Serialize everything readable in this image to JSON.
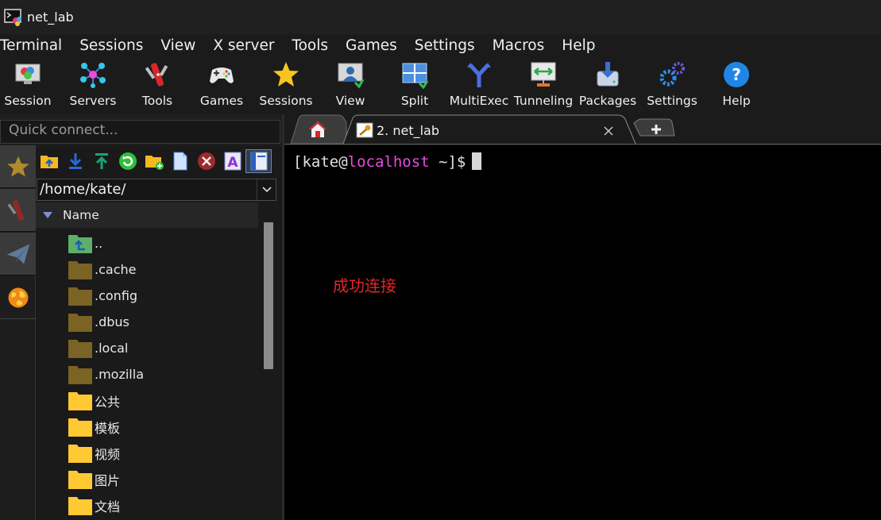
{
  "window": {
    "title": "net_lab"
  },
  "menu": [
    "Terminal",
    "Sessions",
    "View",
    "X server",
    "Tools",
    "Games",
    "Settings",
    "Macros",
    "Help"
  ],
  "toolbar": {
    "session": "Session",
    "servers": "Servers",
    "tools": "Tools",
    "games": "Games",
    "sessions": "Sessions",
    "view": "View",
    "split": "Split",
    "multiexec": "MultiExec",
    "tunneling": "Tunneling",
    "packages": "Packages",
    "settings": "Settings",
    "help": "Help"
  },
  "quick_connect": {
    "placeholder": "Quick connect..."
  },
  "sftp": {
    "path": "/home/kate/",
    "column_header": "Name",
    "files": [
      {
        "name": "..",
        "icon": "parent-folder-icon"
      },
      {
        "name": ".cache",
        "icon": "hidden-folder-icon"
      },
      {
        "name": ".config",
        "icon": "hidden-folder-icon"
      },
      {
        "name": ".dbus",
        "icon": "hidden-folder-icon"
      },
      {
        "name": ".local",
        "icon": "hidden-folder-icon"
      },
      {
        "name": ".mozilla",
        "icon": "hidden-folder-icon"
      },
      {
        "name": "公共",
        "icon": "folder-icon"
      },
      {
        "name": "模板",
        "icon": "folder-icon"
      },
      {
        "name": "视频",
        "icon": "folder-icon"
      },
      {
        "name": "图片",
        "icon": "folder-icon"
      },
      {
        "name": "文档",
        "icon": "folder-icon"
      }
    ]
  },
  "tabs": {
    "active_label": "2. net_lab"
  },
  "terminal": {
    "open_bracket": "[",
    "user": "kate@",
    "host": "localhost",
    "rest": " ~]$"
  },
  "annotation": "成功连接",
  "colors": {
    "accent_pink": "#e84ce0",
    "annotation_red": "#e2242c",
    "folder_yellow": "#ffc933",
    "hidden_folder": "#7a6323"
  }
}
